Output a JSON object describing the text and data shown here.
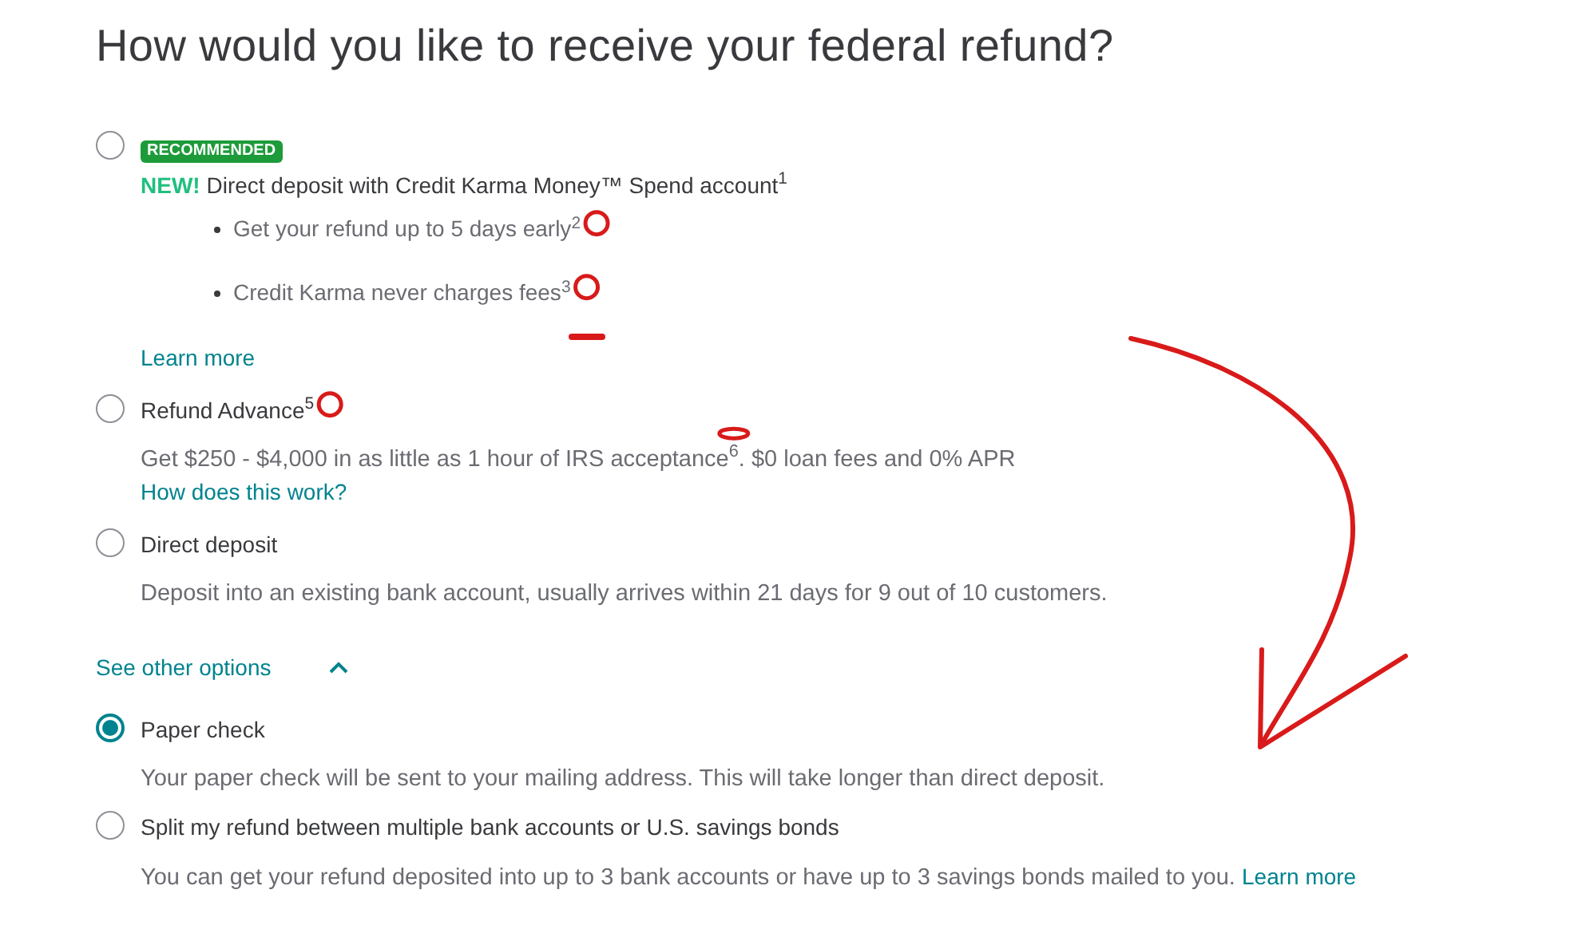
{
  "title": "How would you like to receive your federal refund?",
  "options": [
    {
      "kind": "featured",
      "selected": false,
      "badge": "RECOMMENDED",
      "new_tag": "NEW!",
      "label": "Direct deposit with Credit Karma Money™ Spend account$^{1}$",
      "bullets": [
        "Get your refund up to 5 days early$^{2}$",
        "Credit Karma never charges fees$^{3}$"
      ],
      "link": "Learn more"
    },
    {
      "kind": "standard",
      "selected": false,
      "label": "Refund Advance$^{5}$",
      "description": "Get $250 - $4,000 in as little as 1 hour of IRS acceptance$^{6}$. $0 loan fees and 0% APR",
      "link": "How does this work?"
    },
    {
      "kind": "standard",
      "selected": false,
      "label": "Direct deposit",
      "description": "Deposit into an existing bank account, usually arrives within 21 days for 9 out of 10 customers."
    }
  ],
  "more_toggle": {
    "label": "See other options",
    "expanded": true
  },
  "other_options": [
    {
      "kind": "standard",
      "selected": true,
      "label": "Paper check",
      "description": "Your paper check will be sent to your mailing address. This will take longer than direct deposit."
    },
    {
      "kind": "standard",
      "selected": false,
      "label": "Split my refund between multiple bank accounts or U.S. savings bonds",
      "description": "You can get your refund deposited into up to 3 bank accounts or have up to 3 savings bonds mailed to you.",
      "inline_link": "Learn more"
    }
  ]
}
